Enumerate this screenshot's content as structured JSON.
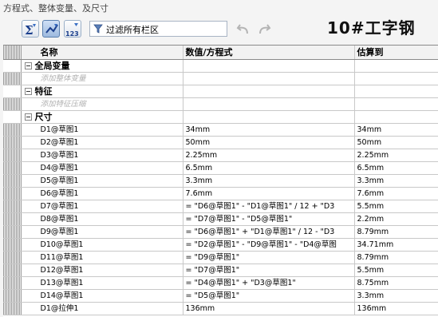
{
  "window": {
    "title": "方程式、整体变量、及尺寸"
  },
  "toolbar": {
    "buttons": [
      {
        "name": "sigma-icon",
        "label": "Σ"
      },
      {
        "name": "global-var-icon",
        "label": ""
      },
      {
        "name": "dimension-icon",
        "label": "123"
      }
    ],
    "filter_label": "过滤所有栏区",
    "big_title": "10#工字钢"
  },
  "table": {
    "headers": {
      "name": "名称",
      "value": "数值/方程式",
      "eval": "估算到"
    },
    "groups": {
      "globals": {
        "label": "全局变量",
        "placeholder": "添加整体变量"
      },
      "features": {
        "label": "特征",
        "placeholder": "添加特征压缩"
      },
      "dims": {
        "label": "尺寸"
      }
    },
    "rows": [
      {
        "name": "D1@草图1",
        "value": "34mm",
        "eval": "34mm"
      },
      {
        "name": "D2@草图1",
        "value": "50mm",
        "eval": "50mm"
      },
      {
        "name": "D3@草图1",
        "value": "2.25mm",
        "eval": "2.25mm"
      },
      {
        "name": "D4@草图1",
        "value": "6.5mm",
        "eval": "6.5mm"
      },
      {
        "name": "D5@草图1",
        "value": "3.3mm",
        "eval": "3.3mm"
      },
      {
        "name": "D6@草图1",
        "value": "7.6mm",
        "eval": "7.6mm"
      },
      {
        "name": "D7@草图1",
        "value": "= \"D6@草图1\" - \"D1@草图1\" / 12 + \"D3",
        "eval": "5.5mm"
      },
      {
        "name": "D8@草图1",
        "value": "= \"D7@草图1\" - \"D5@草图1\"",
        "eval": "2.2mm"
      },
      {
        "name": "D9@草图1",
        "value": "= \"D6@草图1\" + \"D1@草图1\" / 12 - \"D3",
        "eval": "8.79mm"
      },
      {
        "name": "D10@草图1",
        "value": "= \"D2@草图1\" - \"D9@草图1\" - \"D4@草图",
        "eval": "34.71mm"
      },
      {
        "name": "D11@草图1",
        "value": "= \"D9@草图1\"",
        "eval": "8.79mm"
      },
      {
        "name": "D12@草图1",
        "value": "= \"D7@草图1\"",
        "eval": "5.5mm"
      },
      {
        "name": "D13@草图1",
        "value": "= \"D4@草图1\" + \"D3@草图1\"",
        "eval": "8.75mm"
      },
      {
        "name": "D14@草图1",
        "value": "= \"D5@草图1\"",
        "eval": "3.3mm"
      },
      {
        "name": "D1@拉伸1",
        "value": "136mm",
        "eval": "136mm"
      }
    ]
  },
  "colors": {
    "header_bg": "#f2f2f2",
    "grid_line": "#c8c8c8",
    "active_button": "#9db9de"
  }
}
